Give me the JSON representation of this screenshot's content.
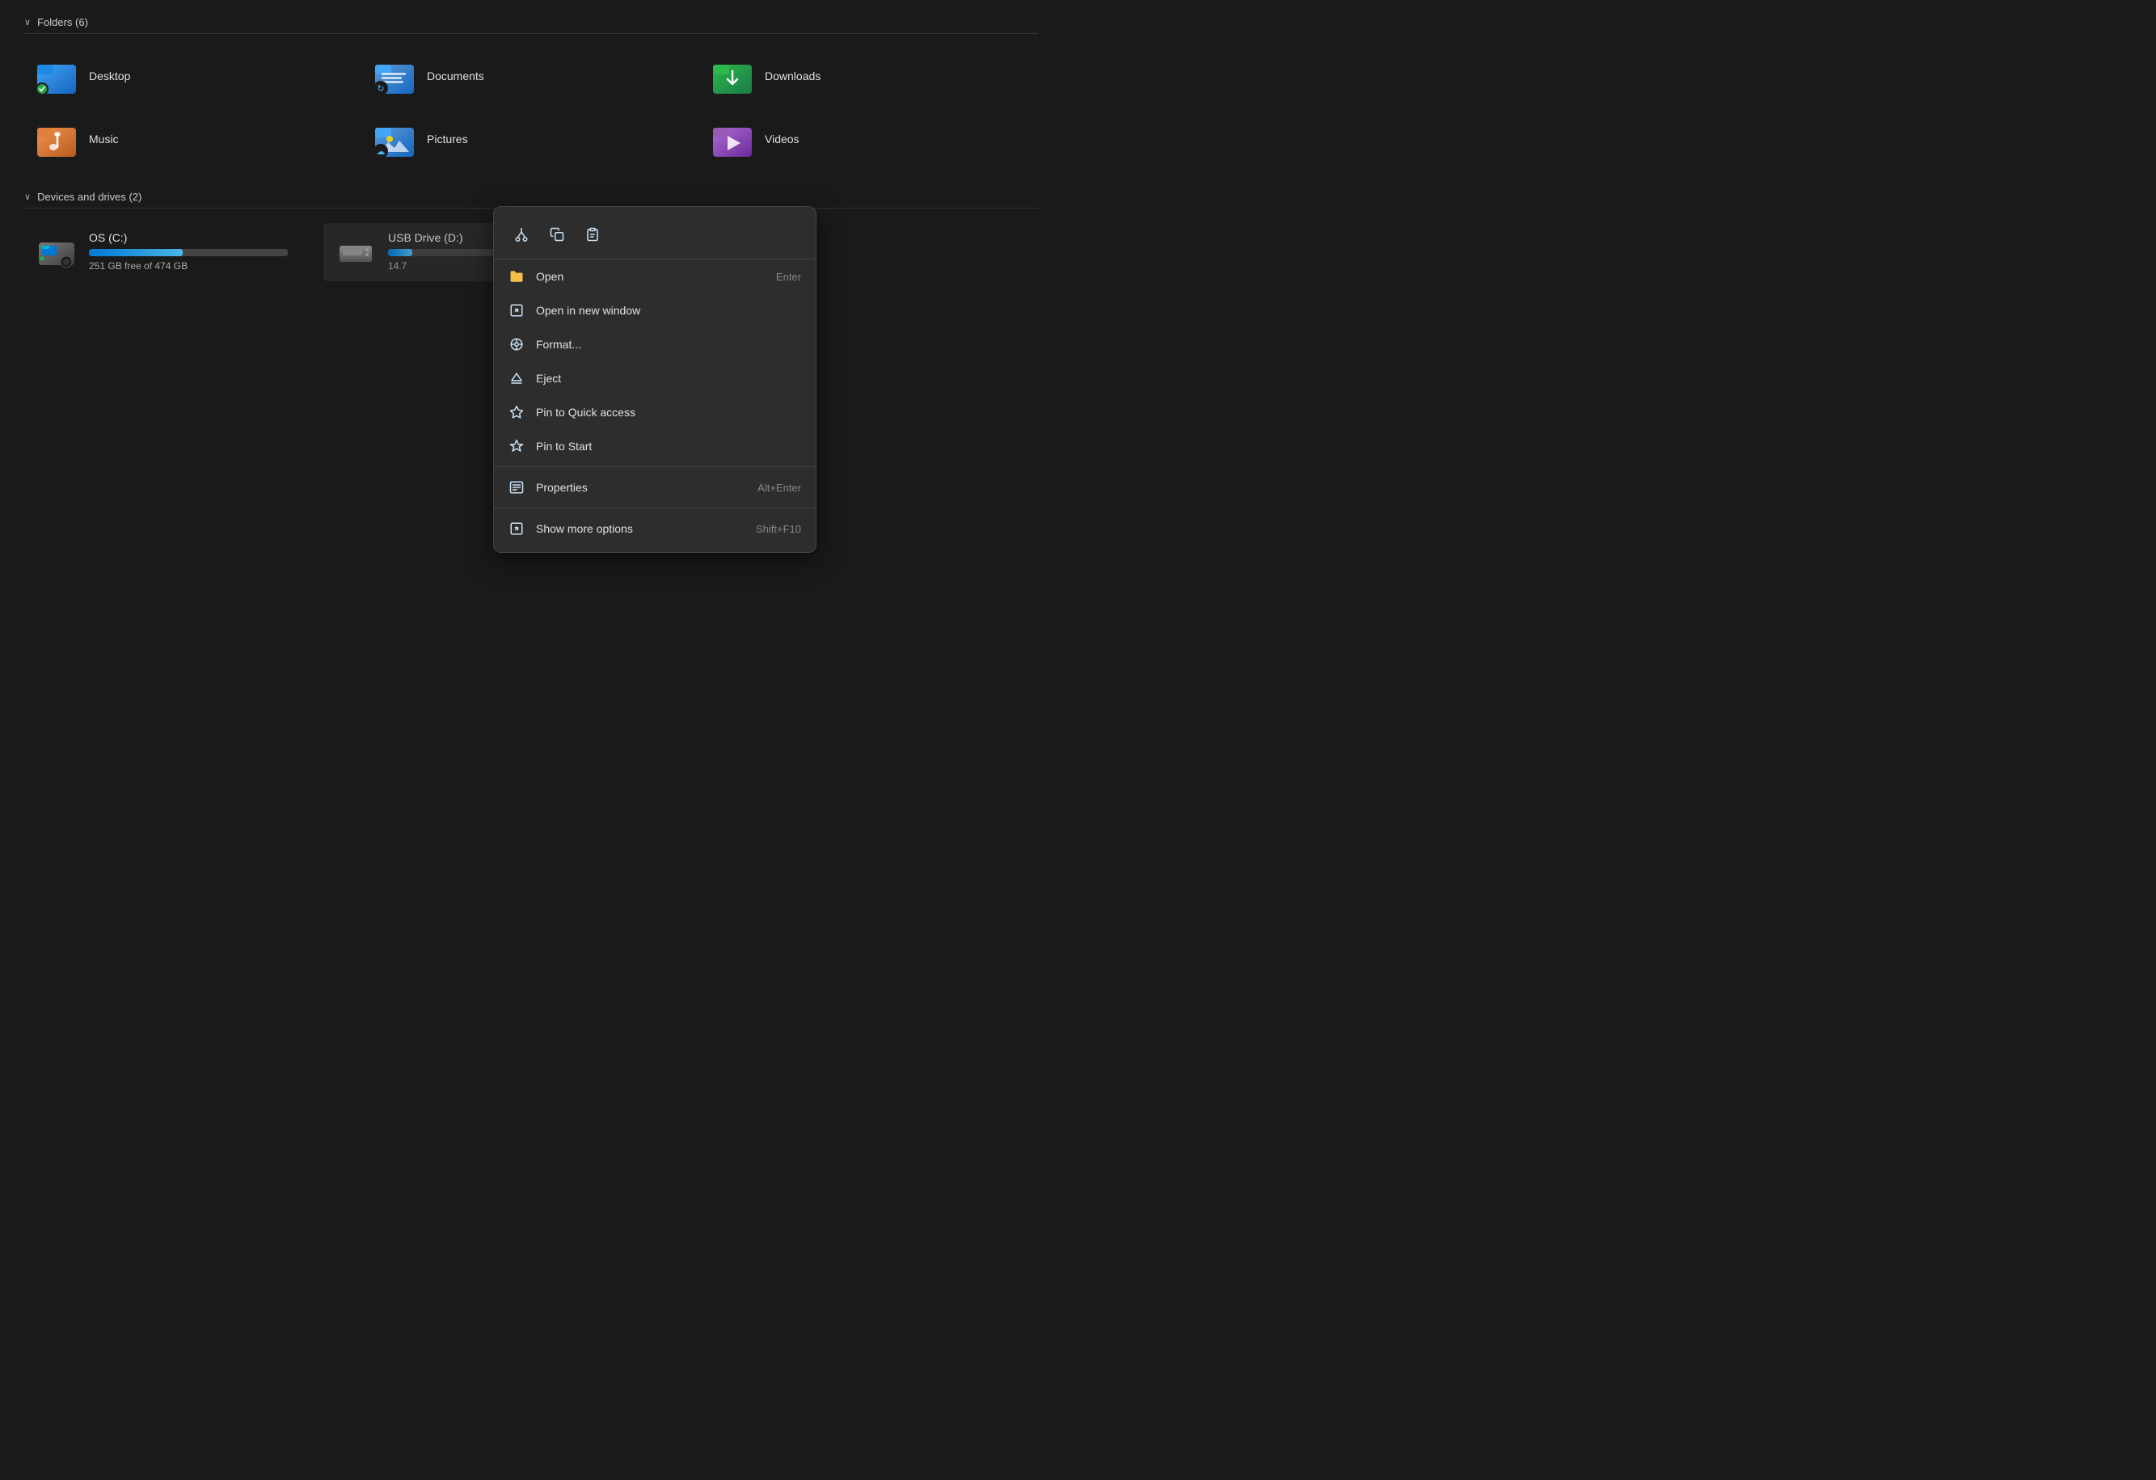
{
  "sections": {
    "folders": {
      "header": "Folders (6)",
      "items": [
        {
          "id": "desktop",
          "name": "Desktop",
          "color": "desktop",
          "hasBadge": true,
          "badgeType": "check"
        },
        {
          "id": "documents",
          "name": "Documents",
          "color": "documents",
          "hasBadge": true,
          "badgeType": "sync"
        },
        {
          "id": "downloads",
          "name": "Downloads",
          "color": "downloads",
          "hasBadge": false
        },
        {
          "id": "music",
          "name": "Music",
          "color": "music",
          "hasBadge": false
        },
        {
          "id": "pictures",
          "name": "Pictures",
          "color": "pictures",
          "hasBadge": true,
          "badgeType": "cloud"
        },
        {
          "id": "videos",
          "name": "Videos",
          "color": "videos",
          "hasBadge": false
        }
      ]
    },
    "devices": {
      "header": "Devices and drives (2)",
      "items": [
        {
          "id": "c-drive",
          "name": "OS (C:)",
          "free": "251 GB free of 474 GB",
          "fillPercent": 47,
          "fillClass": "c-drive"
        },
        {
          "id": "d-drive",
          "name": "USB Drive (D:)",
          "free": "14.7",
          "fillPercent": 12,
          "fillClass": "d-drive"
        }
      ]
    }
  },
  "context_menu": {
    "toolbar_items": [
      {
        "id": "cut",
        "icon": "✂",
        "label": "Cut"
      },
      {
        "id": "copy",
        "icon": "⧉",
        "label": "Copy"
      },
      {
        "id": "paste",
        "icon": "⊡",
        "label": "Paste"
      }
    ],
    "items": [
      {
        "id": "open",
        "icon": "📁",
        "icon_type": "folder-yellow",
        "label": "Open",
        "shortcut": "Enter"
      },
      {
        "id": "open-new-window",
        "icon": "⬚↗",
        "icon_type": "open-window",
        "label": "Open in new window",
        "shortcut": ""
      },
      {
        "id": "format",
        "icon": "⊞",
        "icon_type": "format",
        "label": "Format...",
        "shortcut": ""
      },
      {
        "id": "eject",
        "icon": "⏏",
        "icon_type": "eject",
        "label": "Eject",
        "shortcut": ""
      },
      {
        "id": "pin-quick",
        "icon": "☆",
        "icon_type": "pin-star",
        "label": "Pin to Quick access",
        "shortcut": ""
      },
      {
        "id": "pin-start",
        "icon": "✦",
        "icon_type": "pin-start",
        "label": "Pin to Start",
        "shortcut": ""
      },
      {
        "id": "separator",
        "type": "separator"
      },
      {
        "id": "properties",
        "icon": "☰",
        "icon_type": "properties",
        "label": "Properties",
        "shortcut": "Alt+Enter"
      },
      {
        "id": "separator2",
        "type": "separator"
      },
      {
        "id": "show-more",
        "icon": "⬚↗",
        "icon_type": "more",
        "label": "Show more options",
        "shortcut": "Shift+F10"
      }
    ]
  }
}
